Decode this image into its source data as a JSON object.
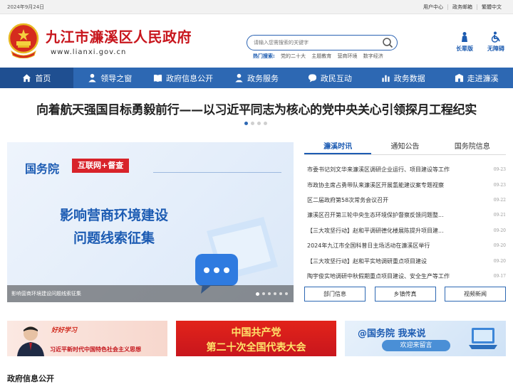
{
  "topbar": {
    "date": "2024年9月24日",
    "links": [
      "用户中心",
      "政务邮箱",
      "繁體中文"
    ]
  },
  "header": {
    "title": "九江市濂溪区人民政府",
    "url": "www.lianxi.gov.cn",
    "emblem_icon": "national-emblem-icon"
  },
  "search": {
    "placeholder": "请输入您需搜索的关键字",
    "hot_label": "热门搜索:",
    "hot_keywords": [
      "党的二十大",
      "主题教育",
      "营商环境",
      "数字经济"
    ]
  },
  "tools": [
    {
      "label": "长辈版",
      "icon": "elder-person-icon"
    },
    {
      "label": "无障碍",
      "icon": "wheelchair-icon"
    }
  ],
  "nav": [
    {
      "label": "首页",
      "icon": "home-icon"
    },
    {
      "label": "领导之窗",
      "icon": "leader-icon"
    },
    {
      "label": "政府信息公开",
      "icon": "book-icon"
    },
    {
      "label": "政务服务",
      "icon": "service-icon"
    },
    {
      "label": "政民互动",
      "icon": "chat-icon"
    },
    {
      "label": "政务数据",
      "icon": "bar-chart-icon"
    },
    {
      "label": "走进濂溪",
      "icon": "building-icon"
    }
  ],
  "headline": "向着航天强国目标勇毅前行——以习近平同志为核心的党中央关心引领探月工程纪实",
  "banner": {
    "org": "国务院",
    "tag": "互联网+督查",
    "line1": "影响营商环境建设",
    "line2": "问题线索征集",
    "caption": "影响营商环境建设问题线索征集"
  },
  "news": {
    "tabs": [
      "濂溪时讯",
      "通知公告",
      "国务院信息"
    ],
    "items": [
      {
        "title": "市委书记刘文华来濂溪区调研企业运行、项目建设等工作",
        "date": "09-23"
      },
      {
        "title": "市政协主席占勇带队来濂溪区开展氢能建议案专题视察",
        "date": "09-23"
      },
      {
        "title": "区二届政府第58次常务会议召开",
        "date": "09-22"
      },
      {
        "title": "濂溪区召开第三轮中央生态环境保护督察反馈问题整...",
        "date": "09-21"
      },
      {
        "title": "【三大攻坚行动】赵和平调研德化楼展陈提升项目建...",
        "date": "09-20"
      },
      {
        "title": "2024年九江市全国科普日主场活动在濂溪区举行",
        "date": "09-20"
      },
      {
        "title": "【三大攻坚行动】赵和平实地调研重点项目建设",
        "date": "09-20"
      },
      {
        "title": "陶宇俊实地调研中秋假期重点项目建设、安全生产等工作",
        "date": "09-17"
      }
    ],
    "buttons": [
      "部门信息",
      "乡镇传真",
      "视频新闻"
    ]
  },
  "promos": [
    {
      "a": "好好学习",
      "b": "习近平新时代中国特色社会主义思想"
    },
    {
      "a": "中国共产党",
      "b": "第二十次全国代表大会"
    },
    {
      "a": "@国务院 我来说",
      "b": "欢迎来留言"
    }
  ],
  "section_title": "政府信息公开",
  "colors": {
    "brand_blue": "#2d68b3",
    "title_red": "#c8161d",
    "nav_active": "#1f4f91"
  }
}
